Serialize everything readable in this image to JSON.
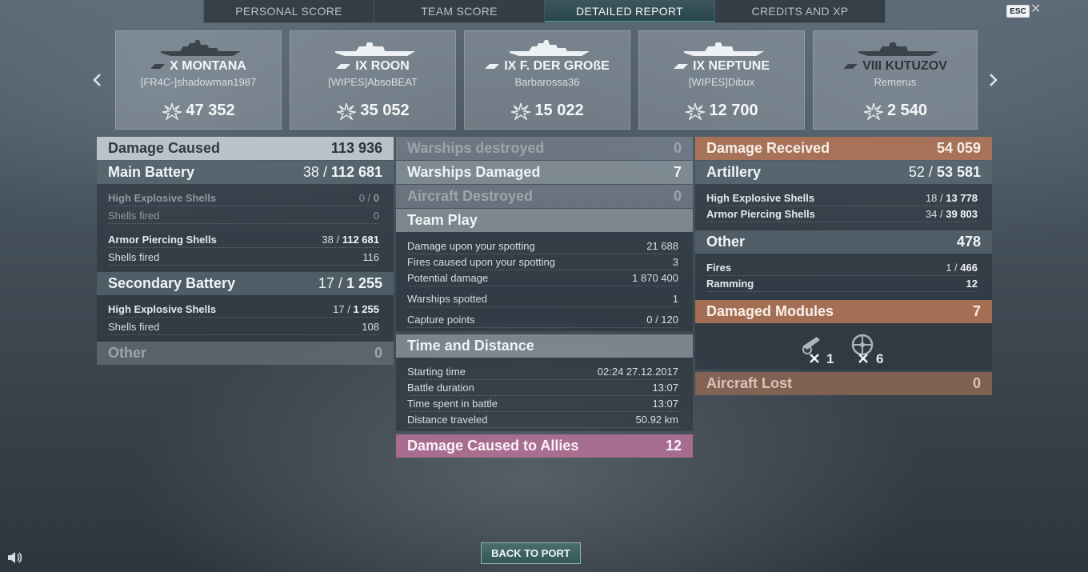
{
  "tabs": [
    "PERSONAL SCORE",
    "TEAM SCORE",
    "DETAILED REPORT",
    "CREDITS AND XP"
  ],
  "esc_label": "ESC",
  "close_glyph": "✕",
  "cards": [
    {
      "ship": "X MONTANA",
      "player": "[FR4C-]shadowman1987",
      "score": "47 352"
    },
    {
      "ship": "IX ROON",
      "player": "[WIPES]AbsoBEAT",
      "score": "35 052"
    },
    {
      "ship": "IX F. DER GROßE",
      "player": "Barbarossa36",
      "score": "15 022"
    },
    {
      "ship": "IX NEPTUNE",
      "player": "[WIPES]Dibux",
      "score": "12 700"
    },
    {
      "ship": "VIII KUTUZOV",
      "player": "Remerus",
      "score": "2 540"
    }
  ],
  "left": {
    "damage_caused": {
      "label": "Damage Caused",
      "value": "113 936"
    },
    "main_battery": {
      "label": "Main Battery",
      "value_a": "38 / ",
      "value_b": "112 681"
    },
    "he_shells": {
      "label": "High Explosive Shells",
      "value_a": "0 / ",
      "value_b": "0"
    },
    "he_fired": {
      "label": "Shells fired",
      "value": "0"
    },
    "ap_shells": {
      "label": "Armor Piercing Shells",
      "value_a": "38 / ",
      "value_b": "112 681"
    },
    "ap_fired": {
      "label": "Shells fired",
      "value": "116"
    },
    "secondary": {
      "label": "Secondary Battery",
      "value_a": "17 / ",
      "value_b": "1 255"
    },
    "sec_he": {
      "label": "High Explosive Shells",
      "value_a": "17 / ",
      "value_b": "1 255"
    },
    "sec_fired": {
      "label": "Shells fired",
      "value": "108"
    },
    "other": {
      "label": "Other",
      "value": "0"
    }
  },
  "middle": {
    "warships_destroyed": {
      "label": "Warships destroyed",
      "value": "0"
    },
    "warships_damaged": {
      "label": "Warships Damaged",
      "value": "7"
    },
    "aircraft_destroyed": {
      "label": "Aircraft Destroyed",
      "value": "0"
    },
    "team_play": {
      "label": "Team Play"
    },
    "dmg_spotting": {
      "label": "Damage upon your spotting",
      "value": "21 688"
    },
    "fires_spotting": {
      "label": "Fires caused upon your spotting",
      "value": "3"
    },
    "potential": {
      "label": "Potential damage",
      "value": "1 870 400"
    },
    "spotted": {
      "label": "Warships spotted",
      "value": "1"
    },
    "capture": {
      "label": "Capture points",
      "value": "0 / 120"
    },
    "time_distance": {
      "label": "Time and Distance"
    },
    "start": {
      "label": "Starting time",
      "value": "02:24  27.12.2017"
    },
    "duration": {
      "label": "Battle duration",
      "value": "13:07"
    },
    "time_spent": {
      "label": "Time spent in battle",
      "value": "13:07"
    },
    "distance": {
      "label": "Distance traveled",
      "value": "50.92 km"
    },
    "allies": {
      "label": "Damage Caused to Allies",
      "value": "12"
    }
  },
  "right": {
    "received": {
      "label": "Damage Received",
      "value": "54 059"
    },
    "artillery": {
      "label": "Artillery",
      "value_a": "52 / ",
      "value_b": "53 581"
    },
    "he": {
      "label": "High Explosive Shells",
      "value_a": "18 / ",
      "value_b": "13 778"
    },
    "ap": {
      "label": "Armor Piercing Shells",
      "value_a": "34 / ",
      "value_b": "39 803"
    },
    "other": {
      "label": "Other",
      "value": "478"
    },
    "fires": {
      "label": "Fires",
      "value_a": "1 / ",
      "value_b": "466"
    },
    "ramming": {
      "label": "Ramming",
      "value": "12"
    },
    "modules": {
      "label": "Damaged Modules",
      "value": "7"
    },
    "module_counts": [
      "1",
      "6"
    ],
    "aircraft_lost": {
      "label": "Aircraft Lost",
      "value": "0"
    }
  },
  "back_button": "BACK TO PORT",
  "colors": {
    "accent": "#34585a",
    "received": "#b07456",
    "allies": "#b07096"
  }
}
